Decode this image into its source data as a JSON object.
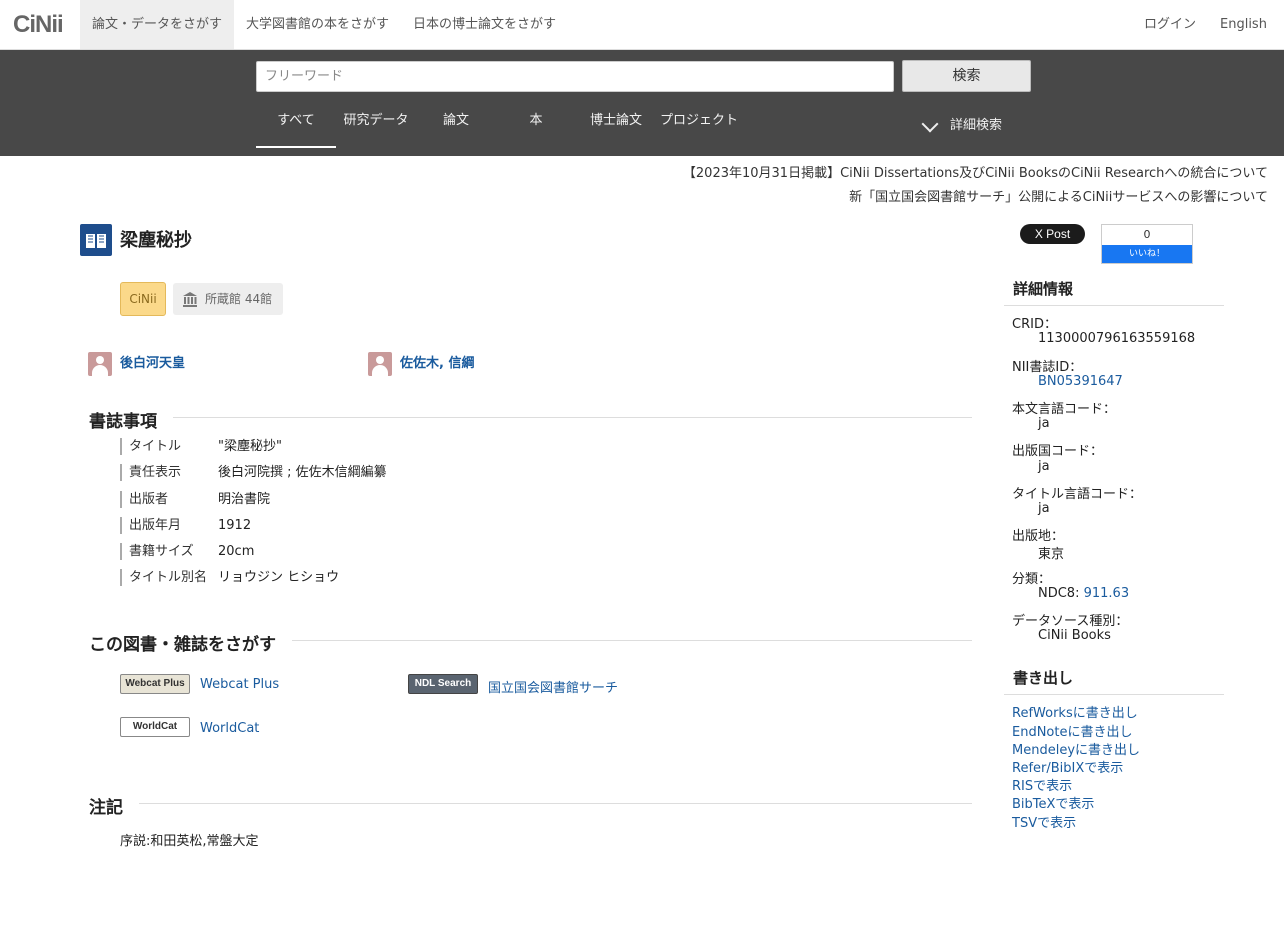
{
  "nav": {
    "logo": "CiNii",
    "tabs": [
      "論文・データをさがす",
      "大学図書館の本をさがす",
      "日本の博士論文をさがす"
    ],
    "login": "ログイン",
    "language": "English"
  },
  "search": {
    "placeholder": "フリーワード",
    "button": "検索",
    "tabs": [
      "すべて",
      "研究データ",
      "論文",
      "本",
      "博士論文",
      "プロジェクト"
    ],
    "advanced": "詳細検索"
  },
  "notices": [
    "【2023年10月31日掲載】CiNii Dissertations及びCiNii BooksのCiNii Researchへの統合について",
    "新「国立国会図書館サーチ」公開によるCiNiiサービスへの影響について"
  ],
  "record": {
    "title": "梁塵秘抄",
    "badge_cinii": "CiNii",
    "holdings": "所蔵館 44館",
    "authors": [
      "後白河天皇",
      "佐佐木, 信綱"
    ]
  },
  "bibliography": {
    "heading": "書誌事項",
    "rows": [
      {
        "label": "タイトル",
        "value": "\"梁塵秘抄\""
      },
      {
        "label": "責任表示",
        "value": "後白河院撰 ; 佐佐木信綱編纂"
      },
      {
        "label": "出版者",
        "value": "明治書院"
      },
      {
        "label": "出版年月",
        "value": "1912"
      },
      {
        "label": "書籍サイズ",
        "value": "20cm"
      },
      {
        "label": "タイトル別名",
        "value": "リョウジン ヒショウ"
      }
    ]
  },
  "find": {
    "heading": "この図書・雑誌をさがす",
    "links": [
      {
        "logo": "Webcat Plus",
        "label": "Webcat Plus"
      },
      {
        "logo": "NDL Search",
        "label": "国立国会図書館サーチ"
      },
      {
        "logo": "WorldCat",
        "label": "WorldCat"
      }
    ]
  },
  "notes": {
    "heading": "注記",
    "text": "序説:和田英松,常盤大定"
  },
  "social": {
    "tweet": "X Post",
    "fb_count": "0",
    "fb_like": "いいね！"
  },
  "details": {
    "heading": "詳細情報",
    "crid_label": "CRID：",
    "crid": "1130000796163559168",
    "nii_label": "NII書誌ID：",
    "nii": "BN05391647",
    "text_lang_label": "本文言語コード：",
    "text_lang": "ja",
    "country_label": "出版国コード：",
    "country": "ja",
    "title_lang_label": "タイトル言語コード：",
    "title_lang": "ja",
    "place_label": "出版地：",
    "place": "東京",
    "class_label": "分類：",
    "class_prefix": "NDC8:",
    "class_value": "911.63",
    "source_label": "データソース種別：",
    "source": "CiNii Books"
  },
  "export": {
    "heading": "書き出し",
    "links": [
      "RefWorksに書き出し",
      "EndNoteに書き出し",
      "Mendeleyに書き出し",
      "Refer/BibIXで表示",
      "RISで表示",
      "BibTeXで表示",
      "TSVで表示"
    ]
  },
  "colors": {
    "band": "#484848",
    "link": "#1a5b9e",
    "badge": "#fbd98a",
    "book_icon": "#1e4d8c"
  }
}
